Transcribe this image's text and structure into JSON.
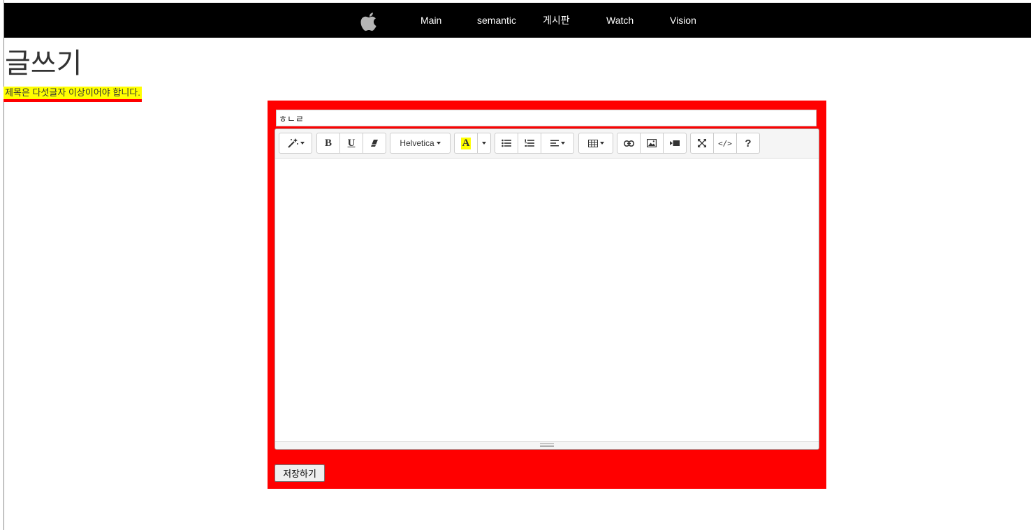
{
  "navbar": {
    "logo_icon": "apple-logo-icon",
    "links": [
      {
        "label": "Main"
      },
      {
        "label": "semantic"
      },
      {
        "label": "게시판"
      },
      {
        "label": "Watch"
      },
      {
        "label": "Vision"
      }
    ]
  },
  "page": {
    "title": "글쓰기",
    "alert_text": "제목은 다섯글자 이상이어야 합니다."
  },
  "form": {
    "title_value": "ㅎㄴㄹ",
    "toolbar": {
      "style_icon": "magic-wand-icon",
      "bold_label": "B",
      "underline_label": "U",
      "eraser_icon": "eraser-icon",
      "font_name": "Helvetica",
      "color_label": "A",
      "color_highlight": "#ffff00",
      "unordered_list_icon": "unordered-list-icon",
      "ordered_list_icon": "ordered-list-icon",
      "align_icon": "align-left-icon",
      "table_icon": "table-icon",
      "link_icon": "link-icon",
      "picture_icon": "picture-icon",
      "video_icon": "video-icon",
      "fullscreen_icon": "fullscreen-icon",
      "codeview_label": "</>",
      "help_label": "?"
    },
    "save_label": "저장하기"
  },
  "colors": {
    "navbar_bg": "#000000",
    "form_bg": "#ff0000",
    "alert_bg": "#ffff00"
  }
}
